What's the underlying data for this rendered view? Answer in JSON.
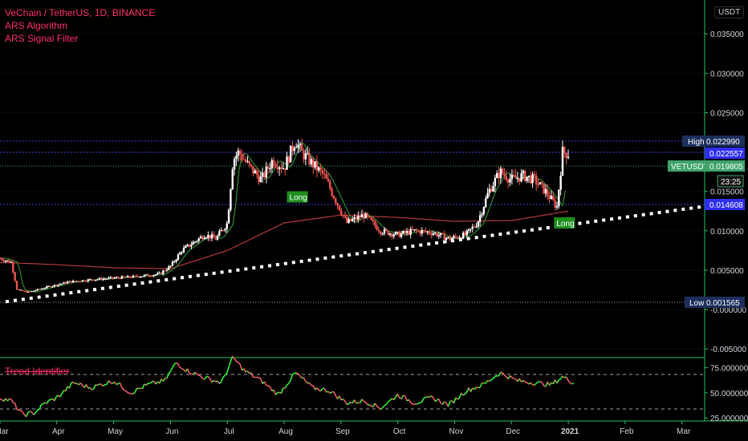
{
  "legend": {
    "title": "VeChain / TetherUS, 1D, BINANCE",
    "indicator1": "ARS Algorithm",
    "indicator2": "ARS Signal Filter",
    "oscillator": "Trend Identifier"
  },
  "currency_button": "USDT",
  "colors": {
    "background": "#000000",
    "up_candle": "#ffffff",
    "down_candle": "#ef5350",
    "signal_long": "#1e8f1e",
    "trendline": "#ffffff",
    "high_low_line": "#3b3bd6",
    "ma_red": "#b33a3a",
    "ma_green": "#2f8a2f",
    "osc_up": "#33ff33",
    "osc_down": "#ff5f6d",
    "tag_blue": "#2e2ef0",
    "tag_navy": "#1c2f5c",
    "tag_green": "#3fa36a",
    "axis_border": "#22c35e"
  },
  "price_axis": {
    "ticks": [
      "0.035000",
      "0.030000",
      "0.025000",
      "0.020000",
      "0.015000",
      "0.010000",
      "0.005000",
      "-0.000000",
      "-0.005000"
    ],
    "tick_values": [
      0.035,
      0.03,
      0.025,
      0.02,
      0.015,
      0.01,
      0.005,
      0.0,
      -0.005
    ]
  },
  "osc_axis": {
    "ticks": [
      "75.000000",
      "50.000000",
      "25.000000"
    ],
    "tick_values": [
      75,
      50,
      25
    ]
  },
  "time_axis": {
    "labels": [
      "Mar",
      "Apr",
      "May",
      "Jun",
      "Jul",
      "Aug",
      "Sep",
      "Oct",
      "Nov",
      "Dec",
      "2021",
      "Feb",
      "Mar"
    ],
    "label_x": [
      0,
      1,
      2,
      3,
      4,
      5,
      6,
      7,
      8,
      9,
      10,
      11,
      12
    ]
  },
  "tags": {
    "high_label": "High",
    "high_value": "0.022990",
    "level1": "0.022557",
    "symbol": "VETUSDT",
    "last_price": "0.019805",
    "countdown": "23:25",
    "level2": "0.014608",
    "low_label": "Low",
    "low_value": "0.001565"
  },
  "signals": [
    {
      "label": "Long",
      "month": 5.05,
      "price": 0.0143
    },
    {
      "label": "Long",
      "month": 9.75,
      "price": 0.011
    }
  ],
  "chart_data": {
    "type": "candlestick",
    "symbol": "VeChain / TetherUS",
    "timeframe": "1D",
    "exchange": "BINANCE",
    "levels": {
      "high": 0.02299,
      "upper": 0.022557,
      "last": 0.019805,
      "lower": 0.014608,
      "low": 0.001565
    },
    "price_path": {
      "months": [
        0.0,
        0.2,
        0.3,
        0.5,
        0.8,
        1.2,
        1.6,
        2.0,
        2.4,
        2.8,
        3.0,
        3.2,
        3.4,
        3.6,
        3.8,
        4.0,
        4.1,
        4.2,
        4.4,
        4.6,
        4.8,
        5.0,
        5.2,
        5.3,
        5.5,
        5.7,
        5.9,
        6.1,
        6.4,
        6.7,
        7.0,
        7.3,
        7.6,
        7.9,
        8.2,
        8.4,
        8.6,
        8.8,
        9.0,
        9.2,
        9.4,
        9.6,
        9.8,
        9.9,
        10.0
      ],
      "close": [
        0.0065,
        0.006,
        0.0025,
        0.0022,
        0.0028,
        0.0035,
        0.0038,
        0.004,
        0.0042,
        0.0045,
        0.0055,
        0.0075,
        0.0085,
        0.0095,
        0.009,
        0.011,
        0.019,
        0.02,
        0.018,
        0.0165,
        0.019,
        0.018,
        0.0215,
        0.02,
        0.0185,
        0.017,
        0.014,
        0.011,
        0.012,
        0.01,
        0.0095,
        0.01,
        0.0098,
        0.009,
        0.0095,
        0.011,
        0.015,
        0.0175,
        0.0165,
        0.017,
        0.0165,
        0.015,
        0.013,
        0.02,
        0.0198
      ]
    },
    "ma_red": {
      "months": [
        0.0,
        1.0,
        2.0,
        3.0,
        4.0,
        5.0,
        6.0,
        7.0,
        8.0,
        9.0,
        10.0
      ],
      "values": [
        0.006,
        0.0057,
        0.0053,
        0.0052,
        0.0075,
        0.011,
        0.012,
        0.0117,
        0.0112,
        0.0113,
        0.0125
      ]
    },
    "trendline": {
      "start": {
        "month": 0.1,
        "price": 0.001
      },
      "end": {
        "month": 12.4,
        "price": 0.0131
      }
    },
    "oscillator": {
      "name": "Trend Identifier",
      "levels": [
        70,
        30
      ],
      "months": [
        0.0,
        0.2,
        0.4,
        0.6,
        0.8,
        1.0,
        1.3,
        1.6,
        2.0,
        2.3,
        2.6,
        2.9,
        3.1,
        3.3,
        3.6,
        3.9,
        4.1,
        4.3,
        4.6,
        4.9,
        5.2,
        5.5,
        5.8,
        6.1,
        6.4,
        6.7,
        7.0,
        7.3,
        7.6,
        7.9,
        8.2,
        8.5,
        8.8,
        9.1,
        9.4,
        9.7,
        9.9,
        10.1
      ],
      "values": [
        45,
        42,
        28,
        30,
        40,
        45,
        60,
        55,
        62,
        50,
        58,
        62,
        80,
        72,
        65,
        60,
        85,
        72,
        62,
        48,
        70,
        55,
        52,
        40,
        42,
        35,
        48,
        40,
        45,
        38,
        52,
        58,
        70,
        62,
        60,
        58,
        66,
        60
      ]
    },
    "axis": {
      "price_range": [
        -0.0061,
        0.0393
      ],
      "osc_range": [
        22,
        85
      ],
      "x_range_months": [
        0,
        12.4
      ]
    }
  }
}
